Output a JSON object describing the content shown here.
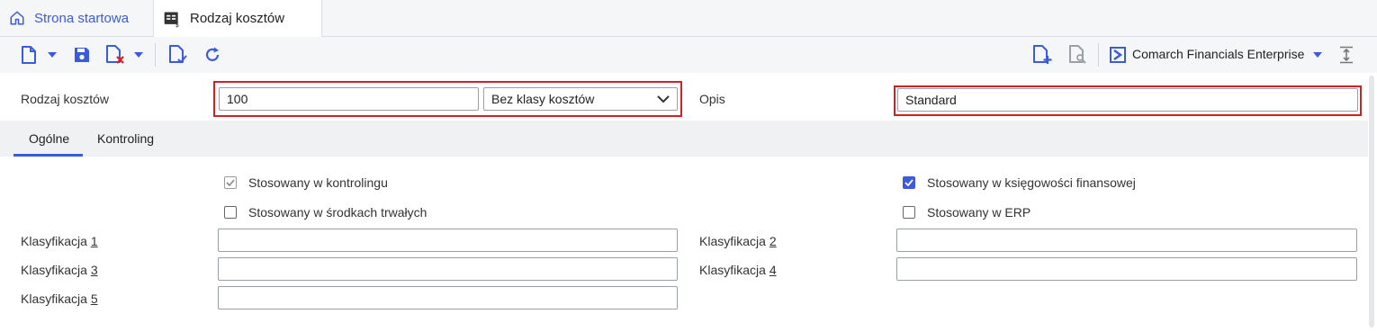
{
  "tabs": {
    "home_label": "Strona startowa",
    "active_label": "Rodzaj kosztów"
  },
  "toolbar": {
    "company": "Comarch Financials Enterprise"
  },
  "header": {
    "cost_type_label": "Rodzaj kosztów",
    "cost_type_value": "100",
    "cost_class_value": "Bez klasy kosztów",
    "description_label": "Opis",
    "description_value": "Standard"
  },
  "subtabs": {
    "general": "Ogólne",
    "controlling": "Kontroling"
  },
  "checkboxes": {
    "controlling": {
      "label": "Stosowany w kontrolingu",
      "checked": true,
      "disabled": true
    },
    "fixed_assets": {
      "label": "Stosowany w środkach trwałych",
      "checked": false
    },
    "financial_accounting": {
      "label": "Stosowany w księgowości finansowej",
      "checked": true
    },
    "erp": {
      "label": "Stosowany w ERP",
      "checked": false
    }
  },
  "classifications": {
    "k1_prefix": "Klasyfikacja ",
    "k1_num": "1",
    "k1_value": "",
    "k2_prefix": "Klasyfikacja ",
    "k2_num": "2",
    "k2_value": "",
    "k3_prefix": "Klasyfikacja ",
    "k3_num": "3",
    "k3_value": "",
    "k4_prefix": "Klasyfikacja ",
    "k4_num": "4",
    "k4_value": "",
    "k5_prefix": "Klasyfikacja ",
    "k5_num": "5",
    "k5_value": ""
  },
  "colors": {
    "accent": "#3b5bdb",
    "highlight": "#d42020"
  }
}
